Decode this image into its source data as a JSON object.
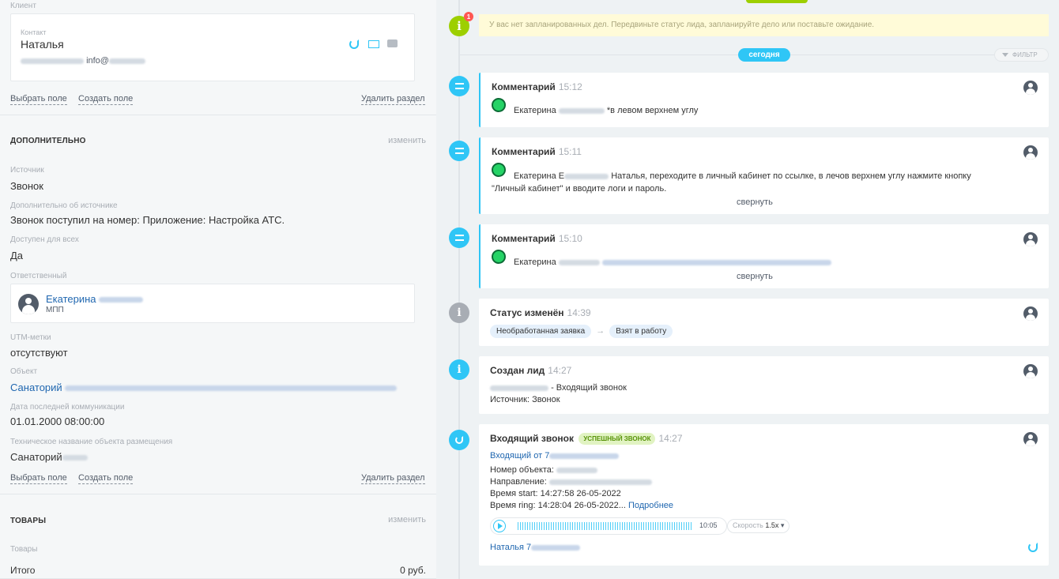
{
  "client": {
    "section_label": "Клиент",
    "contact_label": "Контакт",
    "contact_name": "Наталья",
    "email": "info@",
    "select_field": "Выбрать поле",
    "create_field": "Создать поле",
    "delete_section": "Удалить раздел"
  },
  "extra": {
    "heading": "ДОПОЛНИТЕЛЬНО",
    "edit": "изменить",
    "source_label": "Источник",
    "source": "Звонок",
    "source_extra_label": "Дополнительно об источнике",
    "source_extra": "Звонок поступил на номер: Приложение: Настройка АТС.",
    "public_label": "Доступен для всех",
    "public": "Да",
    "responsible_label": "Ответственный",
    "responsible_name": "Екатерина",
    "responsible_role": "МПП",
    "utm_label": "UTM-метки",
    "utm": "отсутствуют",
    "object_label": "Объект",
    "object": "Санаторий",
    "last_comm_label": "Дата последней коммуникации",
    "last_comm": "01.01.2000 08:00:00",
    "tech_name_label": "Техническое название объекта размещения",
    "tech_name": "Санаторий",
    "select_field": "Выбрать поле",
    "create_field": "Создать поле",
    "delete_section": "Удалить раздел"
  },
  "goods": {
    "heading": "ТОВАРЫ",
    "edit": "изменить",
    "goods_label": "Товары",
    "total_label": "Итого",
    "total": "0 руб."
  },
  "timeline": {
    "notice": "У вас нет запланированных дел. Передвиньте статус лида, запланируйте дело или поставьте ожидание.",
    "notice_badge": "1",
    "today": "сегодня",
    "filter": "ФИЛЬТР",
    "c1": {
      "title": "Комментарий",
      "time": "15:12",
      "author": "Екатерина",
      "text": "*в левом верхнем углу"
    },
    "c2": {
      "title": "Комментарий",
      "time": "15:11",
      "author": "Екатерина Е",
      "text": "Наталья, переходите в личный кабинет по ссылке, в лечов верхнем углу нажмите кнопку",
      "text2": "\"Личный кабинет\" и вводите логи и пароль.",
      "collapse": "свернуть"
    },
    "c3": {
      "title": "Комментарий",
      "time": "15:10",
      "author": "Екатерина",
      "collapse": "свернуть"
    },
    "status": {
      "title": "Статус изменён",
      "time": "14:39",
      "from": "Необработанная заявка",
      "arrow": "→",
      "to": "Взят в работу"
    },
    "lead": {
      "title": "Создан лид",
      "time": "14:27",
      "line1": "- Входящий звонок",
      "line2": "Источник: Звонок"
    },
    "call": {
      "title": "Входящий звонок",
      "badge": "УСПЕШНЫЙ ЗВОНОК",
      "time": "14:27",
      "from": "Входящий от 7",
      "object": "Номер объекта:",
      "direction": "Направление:",
      "start": "Время start: 14:27:58 26-05-2022",
      "ring": "Время ring: 14:28:04 26-05-2022...",
      "more": "Подробнее",
      "duration": "10:05",
      "speed_label": "Скорость",
      "speed": "1.5x",
      "contact": "Наталья 7"
    }
  },
  "colors": {
    "accent": "#2fc6f6",
    "green": "#9dcf00",
    "link": "#2067b0"
  }
}
